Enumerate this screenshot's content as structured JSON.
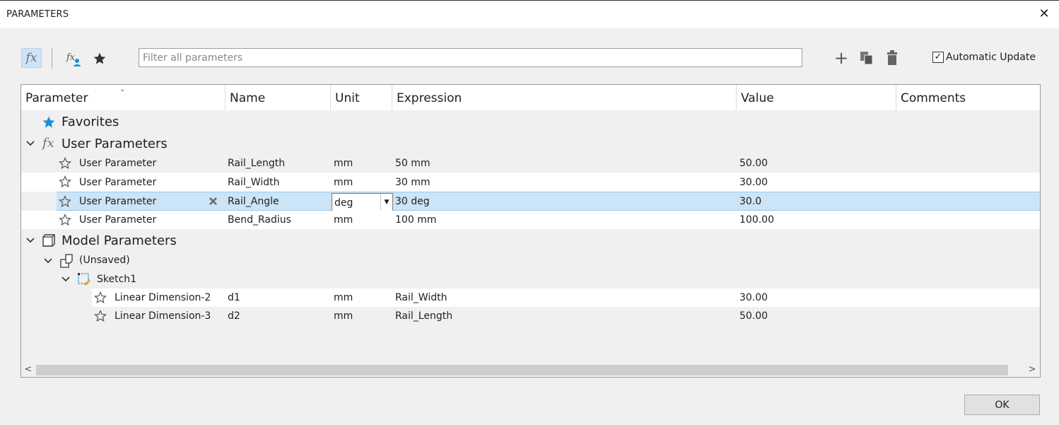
{
  "window": {
    "title": "PARAMETERS",
    "close_glyph": "✕"
  },
  "toolbar": {
    "fx_glyph": "fx",
    "filter_placeholder": "Filter all parameters",
    "add_glyph": "+",
    "automatic_update": {
      "label": "Automatic Update",
      "checked": true,
      "check_glyph": "✓"
    }
  },
  "grid": {
    "columns": [
      "Parameter",
      "Name",
      "Unit",
      "Expression",
      "Value",
      "Comments"
    ],
    "groups": {
      "favorites": "Favorites",
      "user_parameters": "User Parameters",
      "model_parameters": "Model Parameters",
      "component": "(Unsaved)",
      "sketch": "Sketch1"
    },
    "user_rows": [
      {
        "parameter": "User Parameter",
        "name": "Rail_Length",
        "unit": "mm",
        "expression": "50 mm",
        "value": "50.00"
      },
      {
        "parameter": "User Parameter",
        "name": "Rail_Width",
        "unit": "mm",
        "expression": "30 mm",
        "value": "30.00"
      },
      {
        "parameter": "User Parameter",
        "name": "Rail_Angle",
        "unit": "deg",
        "expression": "30 deg",
        "value": "30.0"
      },
      {
        "parameter": "User Parameter",
        "name": "Bend_Radius",
        "unit": "mm",
        "expression": "100 mm",
        "value": "100.00"
      }
    ],
    "model_rows": [
      {
        "parameter": "Linear Dimension-2",
        "name": "d1",
        "unit": "mm",
        "expression": "Rail_Width",
        "value": "30.00"
      },
      {
        "parameter": "Linear Dimension-3",
        "name": "d2",
        "unit": "mm",
        "expression": "Rail_Length",
        "value": "50.00"
      }
    ],
    "scroll_left": "<",
    "scroll_right": ">"
  },
  "footer": {
    "ok_label": "OK"
  },
  "colors": {
    "accent": "#1a8fd8",
    "selected_row": "#cce4f7"
  }
}
